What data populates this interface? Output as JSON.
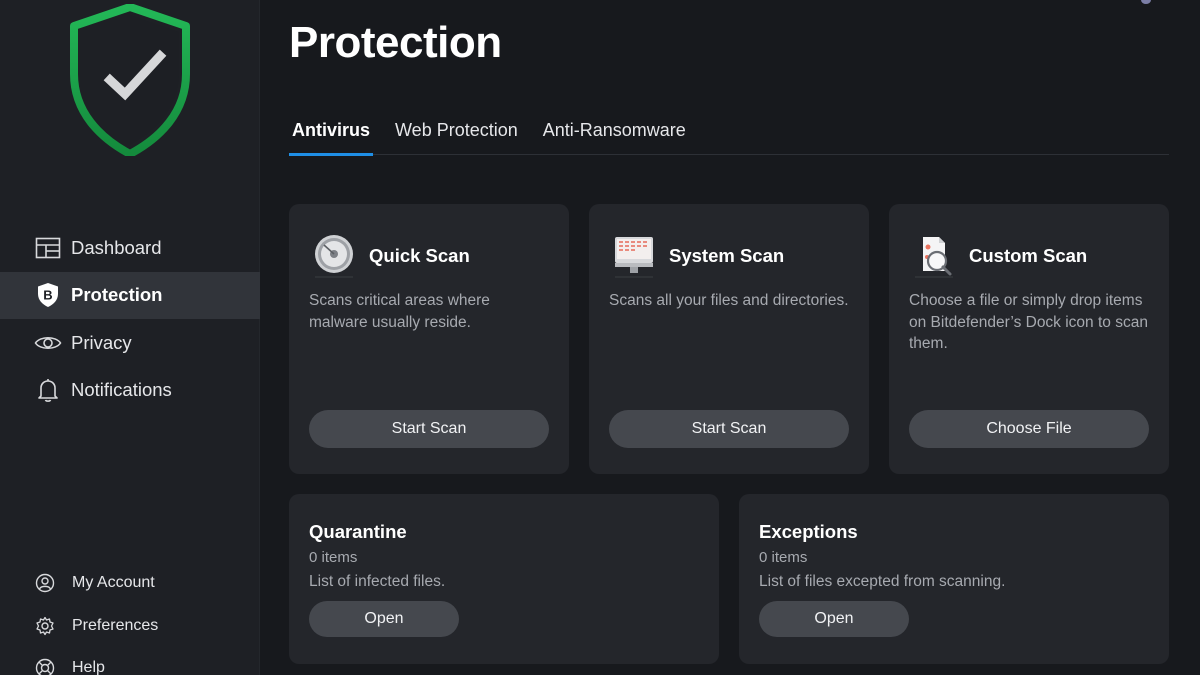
{
  "sidebar": {
    "nav": [
      {
        "label": "Dashboard",
        "icon": "dashboard-icon"
      },
      {
        "label": "Protection",
        "icon": "bitdefender-shield-icon",
        "active": true
      },
      {
        "label": "Privacy",
        "icon": "eye-icon"
      },
      {
        "label": "Notifications",
        "icon": "bell-icon"
      }
    ],
    "bottom": [
      {
        "label": "My Account",
        "icon": "user-circle-icon"
      },
      {
        "label": "Preferences",
        "icon": "gear-icon"
      },
      {
        "label": "Help",
        "icon": "lifebuoy-icon"
      }
    ],
    "logo_icon": "shield-check-icon"
  },
  "main": {
    "title": "Protection",
    "tabs": [
      {
        "label": "Antivirus",
        "active": true
      },
      {
        "label": "Web Protection"
      },
      {
        "label": "Anti-Ransomware"
      }
    ],
    "scan_cards": [
      {
        "title": "Quick Scan",
        "description": "Scans critical areas where malware usually reside.",
        "button": "Start Scan",
        "icon": "quick-scan-icon"
      },
      {
        "title": "System Scan",
        "description": "Scans all your files and directories.",
        "button": "Start Scan",
        "icon": "system-scan-icon"
      },
      {
        "title": "Custom Scan",
        "description": "Choose a file or simply drop items on Bitdefender’s Dock icon to scan them.",
        "button": "Choose File",
        "icon": "custom-scan-icon"
      }
    ],
    "quarantine": {
      "title": "Quarantine",
      "count": "0 items",
      "description": "List of infected files.",
      "button": "Open"
    },
    "exceptions": {
      "title": "Exceptions",
      "count": "0 items",
      "description": "List of files excepted from scanning.",
      "button": "Open"
    }
  },
  "colors": {
    "accent": "#1f8fe6",
    "shield_green": "#1fa84a",
    "background": "#17191d",
    "sidebar": "#1e2025",
    "card": "#24262b",
    "button": "#45484e"
  }
}
